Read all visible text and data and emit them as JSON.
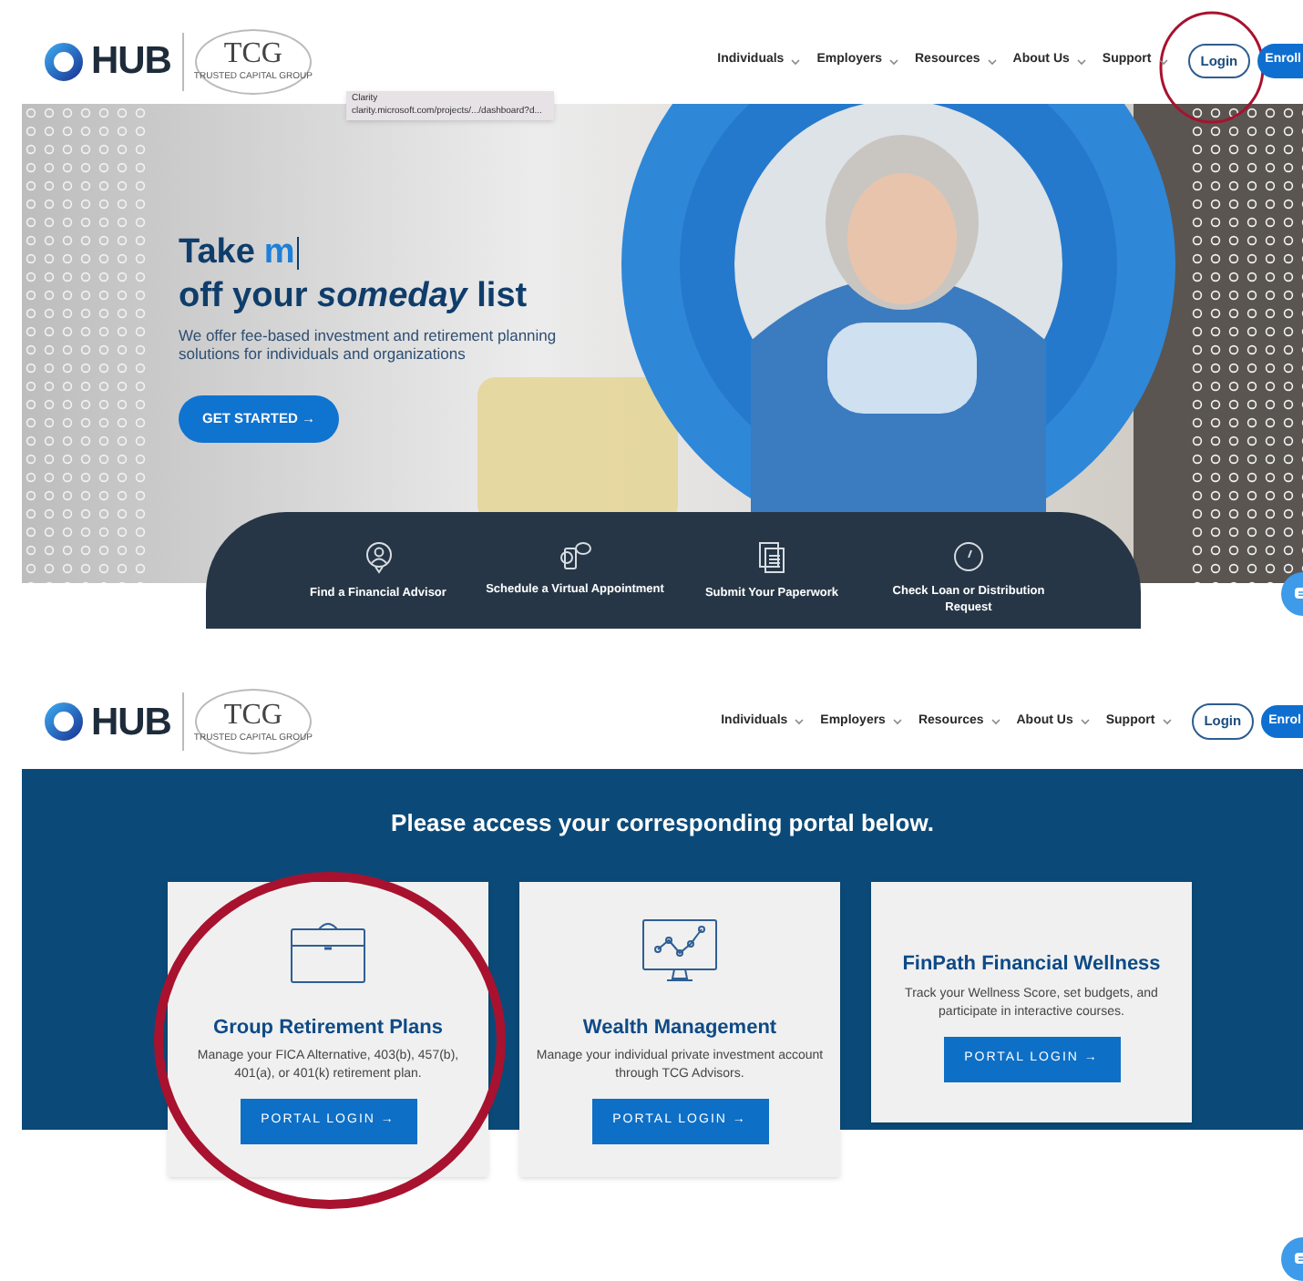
{
  "top_page": {
    "header": {
      "brand": "HUB",
      "partner": "TCG",
      "partner_tagline": "TRUSTED CAPITAL GROUP",
      "nav": [
        "Individuals",
        "Employers",
        "Resources",
        "About Us",
        "Support"
      ],
      "login": "Login",
      "enroll": "Enroll"
    },
    "tooltip": {
      "title": "Clarity",
      "url": "clarity.microsoft.com/projects/.../dashboard?d..."
    },
    "hero": {
      "heading_start": "Take",
      "heading_typed": "m",
      "heading_line2": "off your *someday* list",
      "subtitle": "We offer fee-based investment and retirement planning solutions for individuals and organizations",
      "cta": "GET STARTED →"
    },
    "quick_links": [
      {
        "kind": "advisor",
        "label": "Find a Financial Advisor"
      },
      {
        "kind": "chat",
        "label": "Schedule a Virtual Appointment"
      },
      {
        "kind": "document",
        "label": "Submit Your Paperwork"
      },
      {
        "kind": "gauge",
        "label": "Check Loan or Distribution Request"
      }
    ]
  },
  "bottom_page": {
    "header": {
      "brand": "HUB",
      "partner": "TCG",
      "partner_tagline": "TRUSTED CAPITAL GROUP",
      "nav": [
        "Individuals",
        "Employers",
        "Resources",
        "About Us",
        "Support"
      ],
      "login": "Login",
      "enroll": "Enrol"
    },
    "portal": {
      "title": "Please access your corresponding portal below.",
      "cards": [
        {
          "kind": "briefcase",
          "title": "Group Retirement Plans",
          "description": "Manage your FICA Alternative, 403(b), 457(b), 401(a), or 401(k) retirement plan.",
          "button": "PORTAL LOGIN →"
        },
        {
          "kind": "monitor",
          "title": "Wealth Management",
          "description": "Manage your individual private investment account through TCG Advisors.",
          "button": "PORTAL LOGIN →"
        },
        {
          "kind": "none",
          "title": "FinPath Financial Wellness",
          "description": "Track your Wellness Score, set budgets, and participate in interactive courses.",
          "button": "PORTAL LOGIN →"
        }
      ]
    }
  }
}
